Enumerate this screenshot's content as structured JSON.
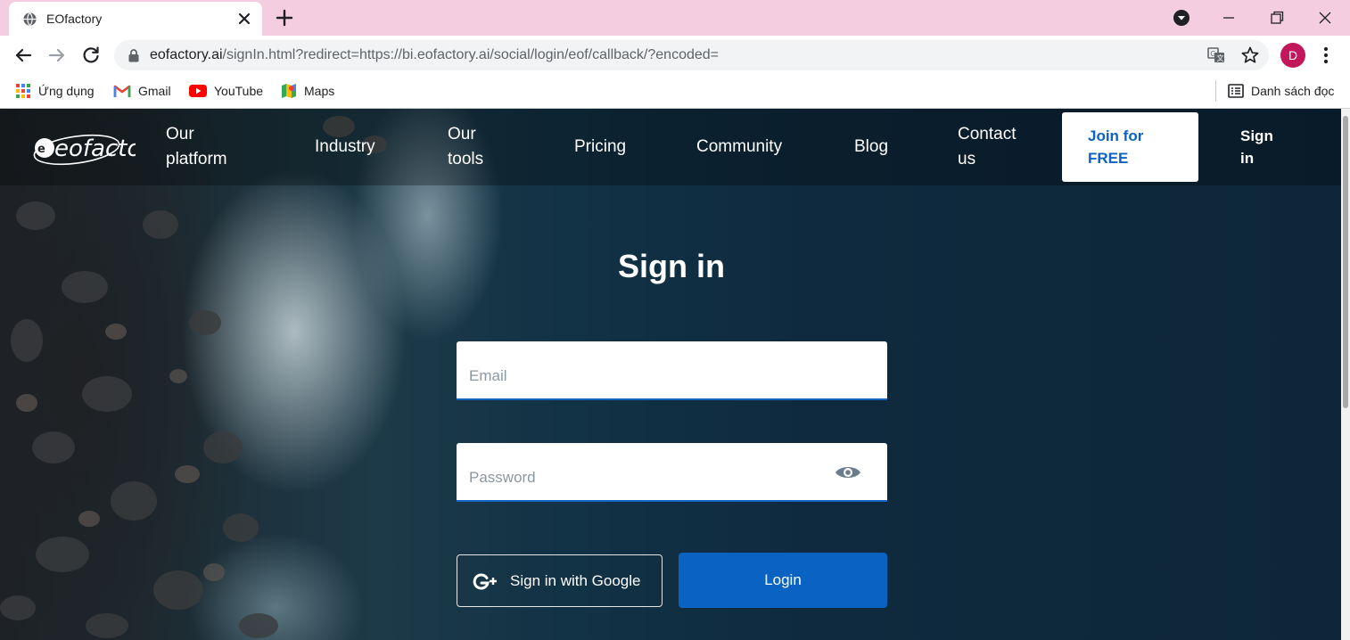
{
  "browser": {
    "tab": {
      "title": "EOfactory",
      "favicon": "globe-icon"
    },
    "url": {
      "host": "eofactory.ai",
      "path": "/signIn.html?redirect=https://bi.eofactory.ai/social/login/eof/callback/?encoded="
    },
    "profile_initial": "D",
    "colors": {
      "tabstrip": "#f4cde1",
      "avatar": "#c2185b"
    }
  },
  "bookmarks": {
    "items": [
      {
        "label": "Ứng dụng",
        "icon": "apps-grid-icon"
      },
      {
        "label": "Gmail",
        "icon": "gmail-icon"
      },
      {
        "label": "YouTube",
        "icon": "youtube-icon"
      },
      {
        "label": "Maps",
        "icon": "maps-icon"
      }
    ],
    "reading_list": "Danh sách đọc"
  },
  "site": {
    "logo_text": "eofactory",
    "nav": [
      {
        "label": "Our platform"
      },
      {
        "label": "Industry"
      },
      {
        "label": "Our tools"
      },
      {
        "label": "Pricing"
      },
      {
        "label": "Community"
      },
      {
        "label": "Blog"
      },
      {
        "label": "Contact us"
      }
    ],
    "join_button": "Join for FREE",
    "signin_link": "Sign in",
    "colors": {
      "primary": "#0a63c2"
    }
  },
  "form": {
    "title": "Sign in",
    "email_placeholder": "Email",
    "email_value": "",
    "password_placeholder": "Password",
    "password_value": "",
    "google_button": "Sign in with Google",
    "login_button": "Login"
  }
}
